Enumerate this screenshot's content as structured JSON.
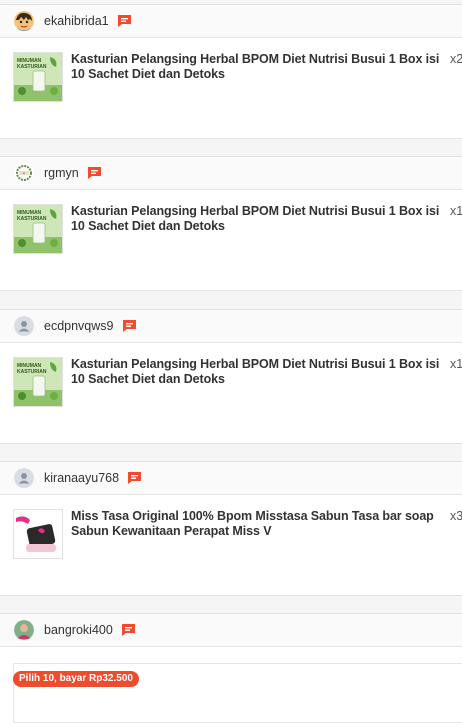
{
  "orders": [
    {
      "username": "ekahibrida1",
      "avatar": "cartoon-avatar",
      "item": {
        "name": "Kasturian Pelangsing Herbal BPOM Diet Nutrisi Busui 1 Box isi 10 Sachet Diet dan Detoks",
        "qty": "x2",
        "thumb_label": "MINUMAN KASTURIAN"
      }
    },
    {
      "username": "rgmyn",
      "avatar": "wreath-avatar",
      "item": {
        "name": "Kasturian Pelangsing Herbal BPOM Diet Nutrisi Busui 1 Box isi 10 Sachet Diet dan Detoks",
        "qty": "x1",
        "thumb_label": "MINUMAN KASTURIAN"
      }
    },
    {
      "username": "ecdpnvqws9",
      "avatar": "default-user-avatar",
      "item": {
        "name": "Kasturian Pelangsing Herbal BPOM Diet Nutrisi Busui 1 Box isi 10 Sachet Diet dan Detoks",
        "qty": "x1",
        "thumb_label": "MINUMAN KASTURIAN"
      }
    },
    {
      "username": "kiranaayu768",
      "avatar": "default-user-avatar",
      "item": {
        "name": "Miss Tasa Original 100% Bpom Misstasa Sabun Tasa bar soap Sabun Kewanitaan Perapat Miss V",
        "qty": "x3"
      }
    },
    {
      "username": "bangroki400",
      "avatar": "photo-avatar",
      "promo": "Pilih 10, bayar Rp32.500"
    }
  ],
  "colors": {
    "accent": "#ee4d2d",
    "background": "#f5f5f5",
    "card": "#ffffff"
  }
}
